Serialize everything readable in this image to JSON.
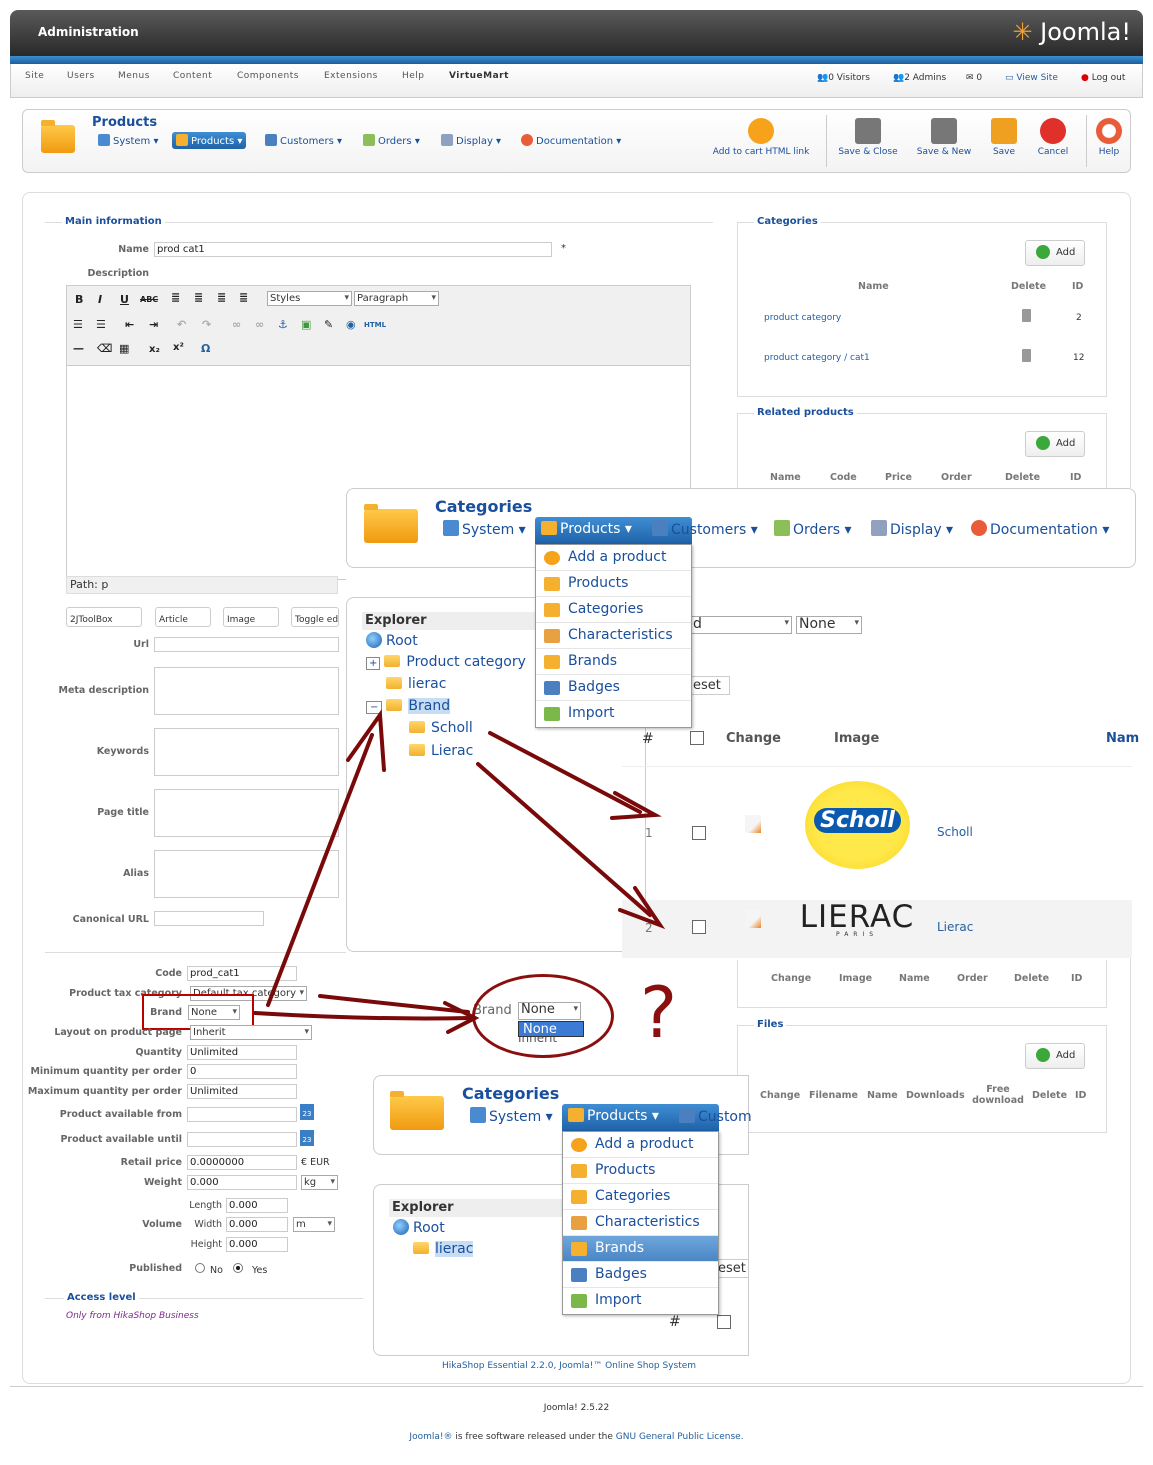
{
  "header": {
    "title": "Administration",
    "logo": "Joomla!"
  },
  "menu": [
    "Site",
    "Users",
    "Menus",
    "Content",
    "Components",
    "Extensions",
    "Help",
    "VirtueMart"
  ],
  "status": {
    "visitors": "0 Visitors",
    "admins": "2 Admins",
    "messages": "0",
    "view_site": "View Site",
    "logout": "Log out"
  },
  "toolbar": {
    "title": "Products",
    "submenu": [
      "System",
      "Products",
      "Customers",
      "Orders",
      "Display",
      "Documentation"
    ],
    "buttons": [
      "Add to cart HTML link",
      "Save & Close",
      "Save & New",
      "Save",
      "Cancel",
      "Help"
    ]
  },
  "main": {
    "legend": "Main information",
    "name_label": "Name",
    "name_value": "prod cat1",
    "required": "*",
    "description_label": "Description",
    "editor": {
      "styles": "Styles",
      "paragraph": "Paragraph",
      "html": "HTML",
      "path": "Path: p"
    },
    "editor_buttons": [
      "2JToolBox",
      "Article",
      "Image",
      "Toggle ed"
    ],
    "fields": {
      "url": "Url",
      "meta": "Meta description",
      "keywords": "Keywords",
      "page_title": "Page title",
      "alias": "Alias",
      "canonical": "Canonical URL"
    }
  },
  "form": {
    "code_l": "Code",
    "code_v": "prod_cat1",
    "tax_l": "Product tax category",
    "tax_v": "Default tax category",
    "brand_l": "Brand",
    "brand_v": "None",
    "layout_l": "Layout on product page",
    "layout_v": "Inherit",
    "qty_l": "Quantity",
    "qty_v": "Unlimited",
    "minq_l": "Minimum quantity per order",
    "minq_v": "0",
    "maxq_l": "Maximum quantity per order",
    "maxq_v": "Unlimited",
    "from_l": "Product available from",
    "until_l": "Product available until",
    "cal": "23",
    "price_l": "Retail price",
    "price_v": "0.0000000",
    "price_unit": "€ EUR",
    "weight_l": "Weight",
    "weight_v": "0.000",
    "weight_unit": "kg",
    "volume_l": "Volume",
    "length_l": "Length",
    "length_v": "0.000",
    "width_l": "Width",
    "width_v": "0.000",
    "width_unit": "m",
    "height_l": "Height",
    "height_v": "0.000",
    "published_l": "Published",
    "no": "No",
    "yes": "Yes",
    "access_legend": "Access level",
    "access_note": "Only from HikaShop Business"
  },
  "categories": {
    "legend": "Categories",
    "add": "Add",
    "cols": [
      "Name",
      "Delete",
      "ID"
    ],
    "rows": [
      {
        "name": "product category",
        "id": "2"
      },
      {
        "name": "product category / cat1",
        "id": "12"
      }
    ]
  },
  "related": {
    "legend": "Related products",
    "add": "Add",
    "cols": [
      "Name",
      "Code",
      "Price",
      "Order",
      "Delete",
      "ID"
    ]
  },
  "images_cols": [
    "Change",
    "Image",
    "Name",
    "Order",
    "Delete",
    "ID"
  ],
  "files": {
    "legend": "Files",
    "add": "Add",
    "cols": [
      "Change",
      "Filename",
      "Name",
      "Downloads",
      "Free download",
      "Delete",
      "ID"
    ]
  },
  "overlay1": {
    "title": "Categories",
    "menu": [
      "System",
      "Products",
      "Customers",
      "Orders",
      "Display",
      "Documentation"
    ],
    "dropdown": [
      "Add a product",
      "Products",
      "Categories",
      "Characteristics",
      "Brands",
      "Badges",
      "Import"
    ],
    "explorer": "Explorer",
    "tree": [
      "Root",
      "Product category",
      "lierac",
      "Brand",
      "Scholl",
      "Lierac"
    ],
    "filter": [
      "d",
      "None"
    ],
    "reset": "eset",
    "cols": [
      "#",
      "Change",
      "Image",
      "Nam"
    ],
    "rows": [
      {
        "n": "1",
        "logo": "Scholl",
        "name": "Scholl"
      },
      {
        "n": "2",
        "logo": "LIERAC",
        "sub": "PARIS",
        "name": "Lierac"
      }
    ]
  },
  "popup": {
    "label": "Brand",
    "value": "None",
    "option": "None",
    "behind": "Inherit",
    "question": "?"
  },
  "overlay2": {
    "title": "Categories",
    "menu": [
      "System",
      "Products",
      "Custom"
    ],
    "dropdown": [
      "Add a product",
      "Products",
      "Categories",
      "Characteristics",
      "Brands",
      "Badges",
      "Import"
    ],
    "explorer": "Explorer",
    "tree": [
      "Root",
      "lierac"
    ],
    "reset": "eset",
    "hash": "#"
  },
  "footer": {
    "hikashop": "HikaShop Essential 2.2.0, Joomla!™ Online Shop System",
    "version": "Joomla! 2.5.22",
    "license_pre": "Joomla!® is free software released under the",
    "license_link": "GNU General Public License."
  }
}
